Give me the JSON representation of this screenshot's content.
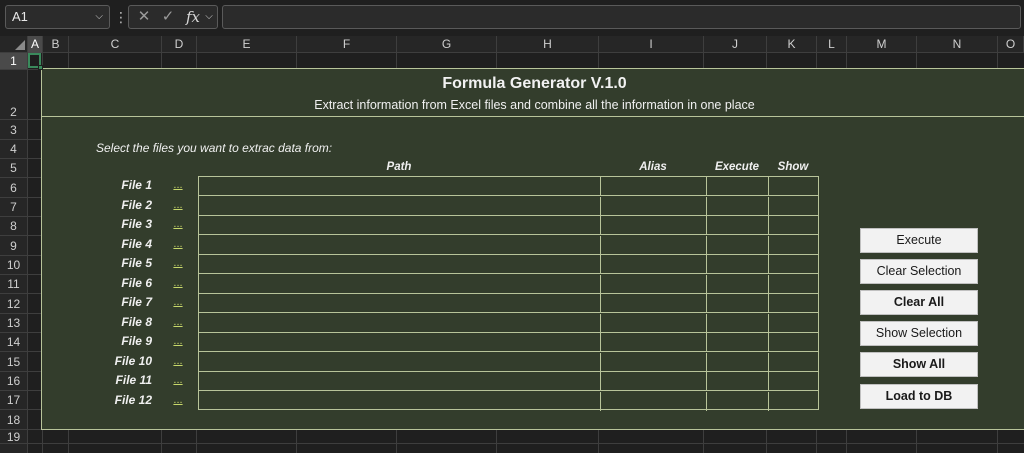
{
  "formula_bar": {
    "name_box": "A1",
    "name_box_arrow": "⌵",
    "more_dots": "⋮",
    "cancel_glyph": "✕",
    "enter_glyph": "✓",
    "fx_label": "fx",
    "fx_arrow": "⌵",
    "formula": ""
  },
  "columns": [
    "A",
    "B",
    "C",
    "D",
    "E",
    "F",
    "G",
    "H",
    "I",
    "J",
    "K",
    "L",
    "M",
    "N",
    "O"
  ],
  "rows": [
    "1",
    "2",
    "3",
    "4",
    "5",
    "6",
    "7",
    "8",
    "9",
    "10",
    "11",
    "12",
    "13",
    "14",
    "15",
    "16",
    "17",
    "18",
    "19"
  ],
  "panel": {
    "title": "Formula Generator V.1.0",
    "subtitle": "Extract information from Excel files and combine all the information in one place",
    "instruction": "Select the files you want to extrac data from:",
    "headers": {
      "path": "Path",
      "alias": "Alias",
      "execute": "Execute",
      "show": "Show"
    },
    "files": [
      {
        "label": "File 1",
        "browse": "..."
      },
      {
        "label": "File 2",
        "browse": "..."
      },
      {
        "label": "File 3",
        "browse": "..."
      },
      {
        "label": "File 4",
        "browse": "..."
      },
      {
        "label": "File 5",
        "browse": "..."
      },
      {
        "label": "File 6",
        "browse": "..."
      },
      {
        "label": "File 7",
        "browse": "..."
      },
      {
        "label": "File 8",
        "browse": "..."
      },
      {
        "label": "File 9",
        "browse": "..."
      },
      {
        "label": "File 10",
        "browse": "..."
      },
      {
        "label": "File 11",
        "browse": "..."
      },
      {
        "label": "File 12",
        "browse": "..."
      }
    ],
    "buttons": {
      "execute": "Execute",
      "clear_selection": "Clear Selection",
      "clear_all": "Clear All",
      "show_selection": "Show Selection",
      "show_all": "Show All",
      "load_to_db": "Load to DB"
    }
  },
  "colors": {
    "panel_bg": "#333d2c",
    "panel_border": "#b8c49a",
    "link": "#c8d86a",
    "selection": "#3a8a5c"
  }
}
